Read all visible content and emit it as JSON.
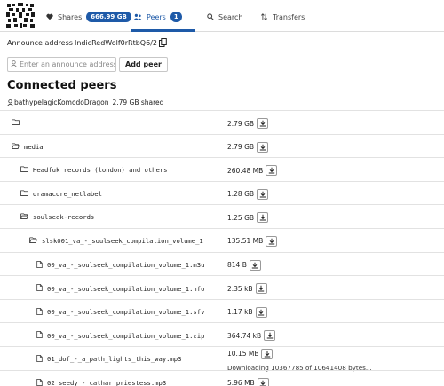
{
  "tabs": {
    "shares": {
      "label": "Shares",
      "size_pill": "666.99 GB"
    },
    "peers": {
      "label": "Peers",
      "count": "1"
    },
    "search": {
      "label": "Search"
    },
    "transfers": {
      "label": "Transfers"
    }
  },
  "announce": {
    "label": "Announce address",
    "address": "IndicRedWolf0rRtbQ6/2",
    "input_placeholder": "Enter an announce address",
    "add_button": "Add peer"
  },
  "connected_peers": {
    "heading": "Connected peers",
    "peer_name": "bathypelagicKomodoDragon",
    "peer_shared": "2.79 GB shared"
  },
  "tree": [
    {
      "type": "folder",
      "name": "",
      "size": "2.79 GB"
    },
    {
      "type": "folder",
      "name": "media",
      "size": "2.79 GB"
    },
    {
      "type": "folder",
      "name": "Headfuk records (london) and others",
      "size": "260.48 MB"
    },
    {
      "type": "folder",
      "name": "dramacore_netlabel",
      "size": "1.28 GB"
    },
    {
      "type": "folder",
      "name": "soulseek-records",
      "size": "1.25 GB"
    },
    {
      "type": "folder",
      "name": "slsk001_va_-_soulseek_compilation_volume_1",
      "size": "135.51 MB"
    },
    {
      "type": "file",
      "name": "00_va_-_soulseek_compilation_volume_1.m3u",
      "size": "814 B"
    },
    {
      "type": "file",
      "name": "00_va_-_soulseek_compilation_volume_1.nfo",
      "size": "2.35 kB"
    },
    {
      "type": "file",
      "name": "00_va_-_soulseek_compilation_volume_1.sfv",
      "size": "1.17 kB"
    },
    {
      "type": "file",
      "name": "00_va_-_soulseek_compilation_volume_1.zip",
      "size": "364.74 kB"
    },
    {
      "type": "file",
      "name": "01_dof_-_a_path_lights_this_way.mp3",
      "size": "10.15 MB",
      "progress_text": "Downloading 10367785 of 10641408 bytes...",
      "progress": 0.974
    },
    {
      "type": "file",
      "name": "02_seedy_-_cathar_priestess.mp3",
      "size": "5.96 MB"
    }
  ],
  "colors": {
    "accent": "#1e5aa8"
  }
}
